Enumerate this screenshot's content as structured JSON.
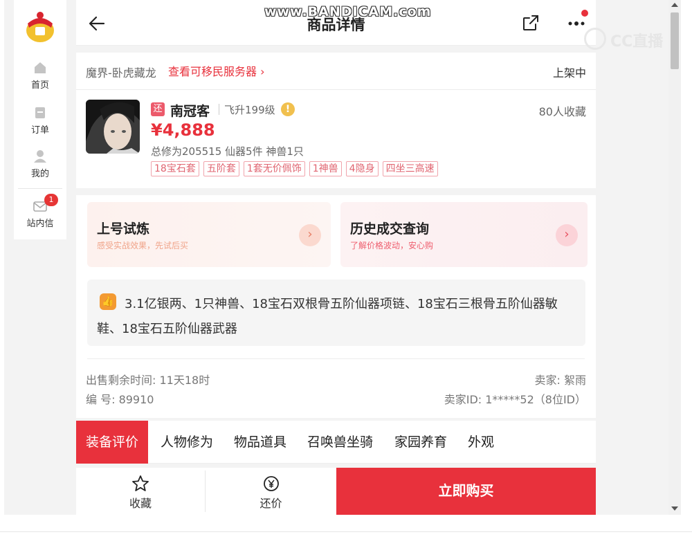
{
  "header": {
    "title": "商品详情"
  },
  "sidebar": {
    "items": [
      {
        "label": "首页",
        "icon": "home-icon"
      },
      {
        "label": "订单",
        "icon": "order-icon"
      },
      {
        "label": "我的",
        "icon": "user-icon"
      },
      {
        "label": "站内信",
        "icon": "mail-icon",
        "badge": "1"
      }
    ]
  },
  "server": {
    "name": "魔界-卧虎藏龙",
    "migrate_link": "查看可移民服务器 ›",
    "status": "上架中"
  },
  "item": {
    "tag": "还",
    "name": "南冠客",
    "level": "飞升199级",
    "favorites": "80人收藏",
    "price": "¥4,888",
    "stats": "总修为205515  仙器5件  神兽1只",
    "tags": [
      "18宝石套",
      "五阶套",
      "1套无价佩饰",
      "1神兽",
      "4隐身",
      "四坐三高速"
    ]
  },
  "promos": [
    {
      "title": "上号试炼",
      "subtitle": "感受实战效果，先试后买"
    },
    {
      "title": "历史成交查询",
      "subtitle": "了解价格波动，安心购"
    }
  ],
  "summary": "3.1亿银两、1只神兽、18宝石双根骨五阶仙器项链、18宝石三根骨五阶仙器敏鞋、18宝石五阶仙器武器",
  "meta": {
    "time_left": "出售剩余时间: 11天18时",
    "serial": "编 号: 89910",
    "seller": "卖家: 絮雨",
    "seller_id": "卖家ID: 1*****52（8位ID）"
  },
  "tabs": [
    "装备评价",
    "人物修为",
    "物品道具",
    "召唤兽坐骑",
    "家园养育",
    "外观"
  ],
  "bottom": {
    "favorite": "收藏",
    "bargain": "还价",
    "buy": "立即购买"
  },
  "overlays": {
    "watermark": "www.BANDICAM.com",
    "cc": "CC直播"
  },
  "colors": {
    "accent": "#e8313c",
    "tag_border": "#f0a4ac",
    "warn": "#f1c04e"
  }
}
